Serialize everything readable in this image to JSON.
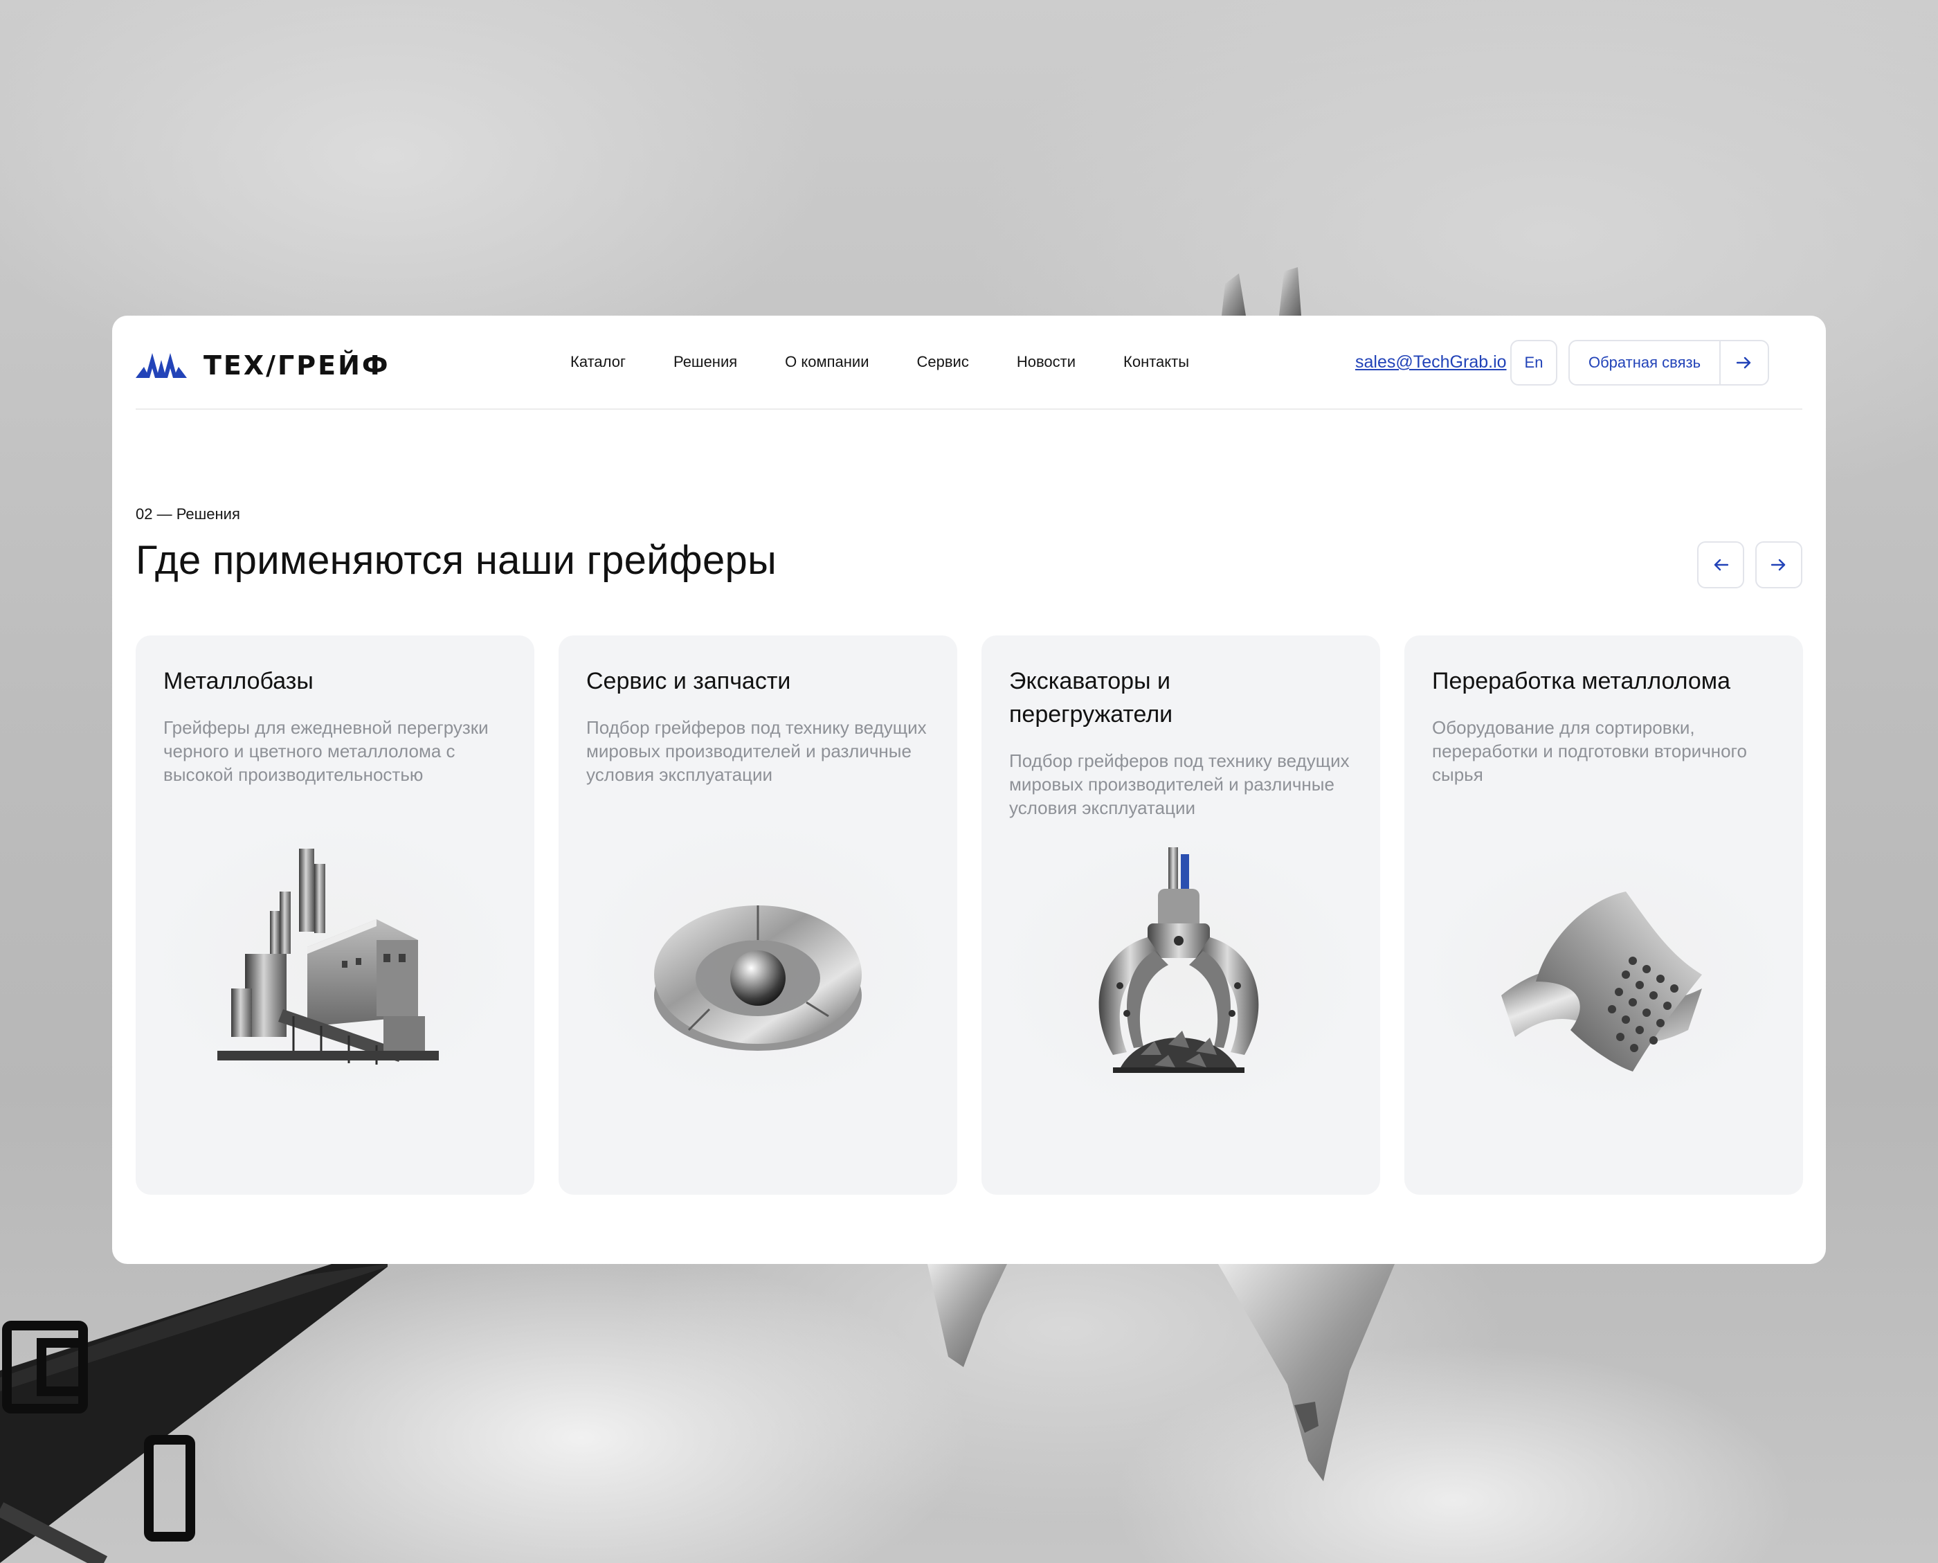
{
  "header": {
    "logo_text": "ТЕХ/ГРЕЙФ",
    "nav": [
      "Каталог",
      "Решения",
      "О компании",
      "Сервис",
      "Новости",
      "Контакты"
    ],
    "email": "sales@TechGrab.io",
    "lang": "En",
    "feedback_label": "Обратная связь"
  },
  "section": {
    "kicker": "02 — Решения",
    "title": "Где применяются наши грейферы"
  },
  "cards": [
    {
      "title": "Металлобазы",
      "text": "Грейферы для ежедневной перегрузки черного и цветного металлолома с высокой производительностью",
      "icon": "factory-icon"
    },
    {
      "title": "Сервис и запчасти",
      "text": "Подбор грейферов под технику ведущих мировых производителей и различные условия эксплуатации",
      "icon": "ring-sphere-icon"
    },
    {
      "title": "Экскаваторы и перегружатели",
      "text": "Подбор грейферов под технику ведущих мировых производителей и различные условия эксплуатации",
      "icon": "grapple-icon"
    },
    {
      "title": "Переработка металлолома",
      "text": "Оборудование для сортировки, переработки и подготовки вторичного сырья",
      "icon": "metal-sheets-icon"
    }
  ],
  "colors": {
    "accent": "#2243b8",
    "card_bg": "#f3f4f6",
    "text_secondary": "#8e9197"
  }
}
